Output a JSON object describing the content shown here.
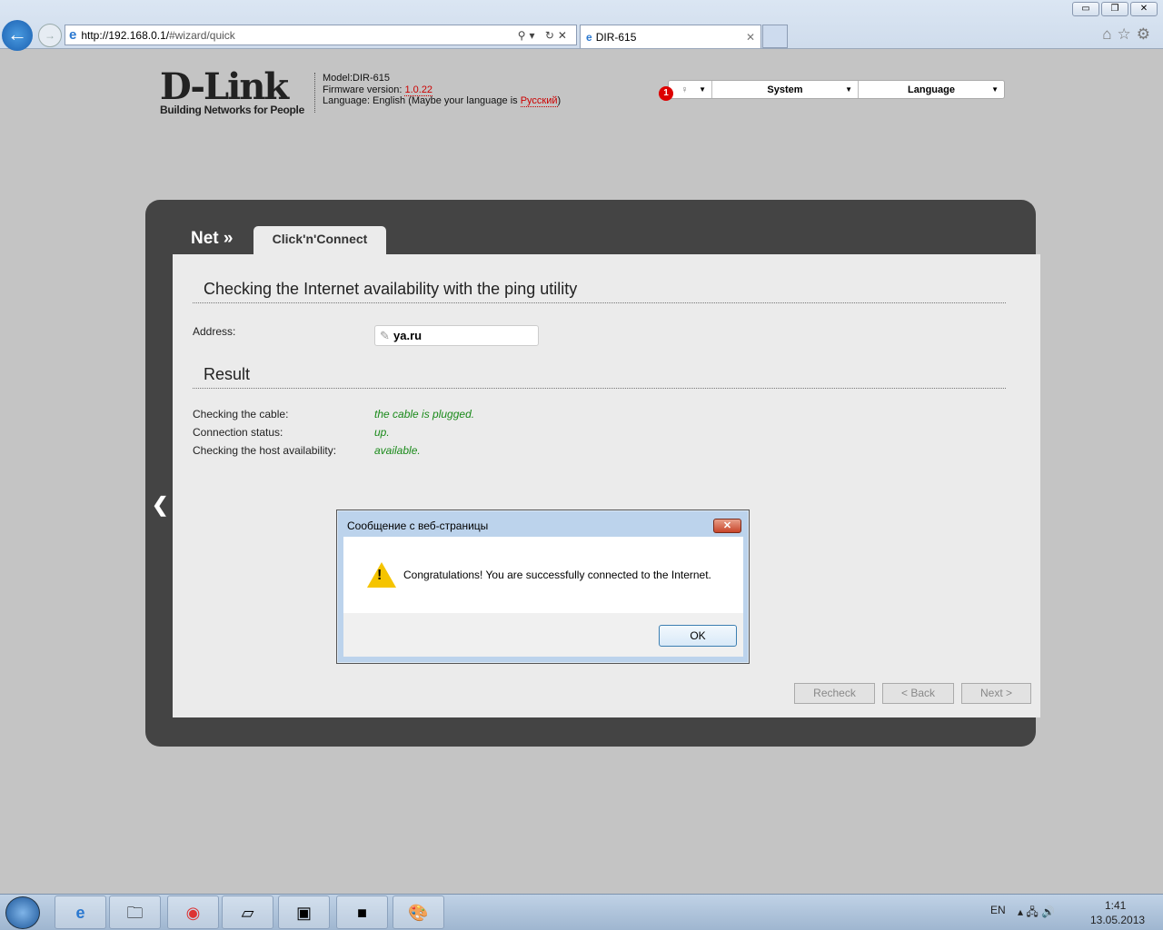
{
  "browser": {
    "url_host": "http://192.168.0.1/",
    "url_path": "#wizard/quick",
    "tab_title": "DIR-615",
    "window_controls": [
      "minimize",
      "restore",
      "close"
    ]
  },
  "header": {
    "logo": "D-Link",
    "logo_tagline": "Building Networks for People",
    "model": "Model:DIR-615",
    "firmware_label": "Firmware version: ",
    "firmware_version": "1.0.22",
    "language_prefix": "Language: English (Maybe your language is ",
    "language_link": "Русский",
    "language_suffix": ")",
    "notification_count": "1",
    "menu": {
      "system": "System",
      "language": "Language"
    }
  },
  "wizard": {
    "breadcrumb": "Net »",
    "tab": "Click'n'Connect",
    "section_title": "Checking the Internet availability with the ping utility",
    "address_label": "Address:",
    "address_value": "ya.ru",
    "result_title": "Result",
    "results": [
      {
        "label": "Checking the cable:",
        "value": "the cable is plugged."
      },
      {
        "label": "Connection status:",
        "value": "up."
      },
      {
        "label": "Checking the host availability:",
        "value": "available."
      }
    ],
    "buttons": {
      "recheck": "Recheck",
      "back": "< Back",
      "next": "Next >"
    }
  },
  "dialog": {
    "title": "Сообщение с веб-страницы",
    "message": "Congratulations! You are successfully connected to the Internet.",
    "ok": "OK"
  },
  "taskbar": {
    "lang": "EN",
    "time": "1:41",
    "date": "13.05.2013"
  }
}
